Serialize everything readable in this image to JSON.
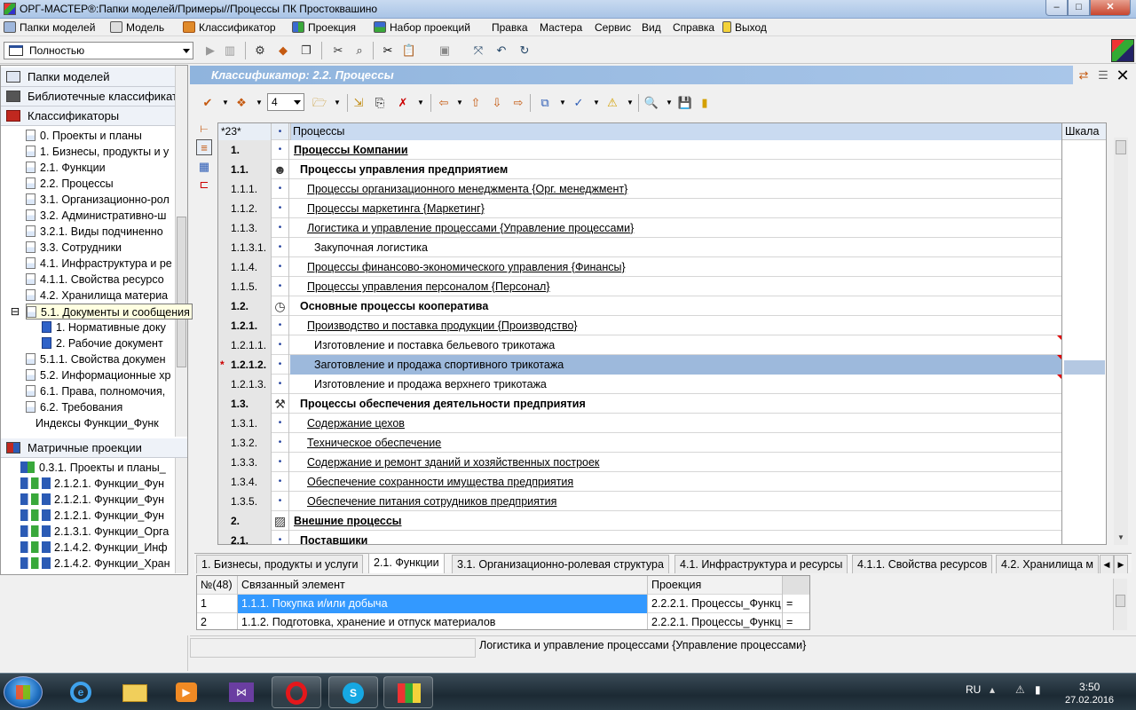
{
  "window": {
    "title": "ОРГ-МАСТЕР®:Папки моделей/Примеры//Процессы ПК Простоквашино",
    "min": "–",
    "max": "□",
    "close": "✕"
  },
  "menu": [
    "Папки моделей",
    "Модель",
    "Классификатор",
    "Проекция",
    "Набор проекций",
    "Правка",
    "Мастера",
    "Сервис",
    "Вид",
    "Справка",
    "Выход"
  ],
  "toolbar": {
    "view_mode": "Полностью",
    "level": "4"
  },
  "left": {
    "sections": [
      "Папки моделей",
      "Библиотечные классификато",
      "Классификаторы",
      "Матричные проекции"
    ],
    "classifiers": [
      "0. Проекты и планы",
      "1. Бизнесы, продукты и у",
      "2.1. Функции",
      "2.2. Процессы",
      "3.1. Организационно-рол",
      "3.2. Административно-ш",
      "3.2.1. Виды подчиненно",
      "3.3. Сотрудники",
      "4.1. Инфраструктура и ре",
      "4.1.1. Свойства ресурсо",
      "4.2. Хранилища материа",
      "5.1. Документы и сообщения",
      "1. Нормативные доку",
      "2. Рабочие документ",
      "5.1.1. Свойства докумен",
      "5.2. Информационные хр",
      "6.1. Права, полномочия,",
      "6.2. Требования",
      "Индексы Функции_Функ"
    ],
    "projections": [
      "0.3.1. Проекты и планы_",
      "2.1.2.1. Функции_Фун",
      "2.1.2.1. Функции_Фун",
      "2.1.2.1. Функции_Фун",
      "2.1.3.1. Функции_Орга",
      "2.1.4.2. Функции_Инф",
      "2.1.4.2. Функции_Хран"
    ]
  },
  "panel_title": "Классификатор: 2.2. Процессы",
  "grid": {
    "header": {
      "num": "*23*",
      "name": "Процессы",
      "scale": "Шкала"
    },
    "rows": [
      {
        "num": "1.",
        "name": "Процессы Компании",
        "marker": "•",
        "mod": ""
      },
      {
        "num": "1.1.",
        "name": "Процессы управления предприятием",
        "marker": "",
        "mod": ""
      },
      {
        "num": "1.1.1.",
        "name": "Процессы организационного менеджмента {Орг. менеджмент}",
        "marker": "•",
        "mod": ""
      },
      {
        "num": "1.1.2.",
        "name": "Процессы маркетинга {Маркетинг}",
        "marker": "•",
        "mod": ""
      },
      {
        "num": "1.1.3.",
        "name": "Логистика и управление процессами {Управление процессами}",
        "marker": "•",
        "mod": ""
      },
      {
        "num": "1.1.3.1.",
        "name": "Закупочная логистика",
        "marker": "•",
        "mod": ""
      },
      {
        "num": "1.1.4.",
        "name": "Процессы финансово-экономического управления {Финансы}",
        "marker": "•",
        "mod": ""
      },
      {
        "num": "1.1.5.",
        "name": "Процессы управления персоналом {Персонал}",
        "marker": "•",
        "mod": ""
      },
      {
        "num": "1.2.",
        "name": "Основные процессы кооператива",
        "marker": "",
        "mod": ""
      },
      {
        "num": "1.2.1.",
        "name": "Производство и поставка продукции {Производство}",
        "marker": "•",
        "mod": ""
      },
      {
        "num": "1.2.1.1.",
        "name": "Изготовление и поставка бельевого трикотажа",
        "marker": "•",
        "mod": ""
      },
      {
        "num": "1.2.1.2.",
        "name": "Заготовление и продажа спортивного трикотажа",
        "marker": "•",
        "mod": "*"
      },
      {
        "num": "1.2.1.3.",
        "name": "Изготовление и продажа верхнего трикотажа",
        "marker": "•",
        "mod": ""
      },
      {
        "num": "1.3.",
        "name": "Процессы обеспечения деятельности предприятия",
        "marker": "",
        "mod": ""
      },
      {
        "num": "1.3.1.",
        "name": "Содержание цехов",
        "marker": "•",
        "mod": ""
      },
      {
        "num": "1.3.2.",
        "name": "Техническое обеспечение",
        "marker": "•",
        "mod": ""
      },
      {
        "num": "1.3.3.",
        "name": "Содержание и ремонт зданий и хозяйственных построек",
        "marker": "•",
        "mod": ""
      },
      {
        "num": "1.3.4.",
        "name": "Обеспечение сохранности имущества предприятия",
        "marker": "•",
        "mod": ""
      },
      {
        "num": "1.3.5.",
        "name": "Обеспечение питания сотрудников предприятия",
        "marker": "•",
        "mod": ""
      },
      {
        "num": "2.",
        "name": "Внешние процессы",
        "marker": "",
        "mod": ""
      },
      {
        "num": "2.1.",
        "name": "Поставщики",
        "marker": "•",
        "mod": ""
      }
    ]
  },
  "tabs": [
    "1. Бизнесы, продукты и услуги",
    "2.1. Функции",
    "3.1. Организационно-ролевая структура",
    "4.1. Инфраструктура и ресурсы",
    "4.1.1. Свойства ресурсов",
    "4.2. Хранилища м"
  ],
  "relations": {
    "headers": [
      "№(48)",
      "Связанный элемент",
      "Проекция"
    ],
    "rows": [
      {
        "n": "1",
        "element": "1.1.1. Покупка и/или добыча",
        "projection": "2.2.2.1. Процессы_Функц",
        "op": "="
      },
      {
        "n": "2",
        "element": "1.1.2. Подготовка, хранение и отпуск материалов",
        "projection": "2.2.2.1. Процессы_Функц",
        "op": "="
      }
    ]
  },
  "status": {
    "text": "Логистика и управление процессами {Управление процессами}"
  },
  "tray": {
    "lang": "RU",
    "time": "3:50",
    "date": "27.02.2016"
  }
}
